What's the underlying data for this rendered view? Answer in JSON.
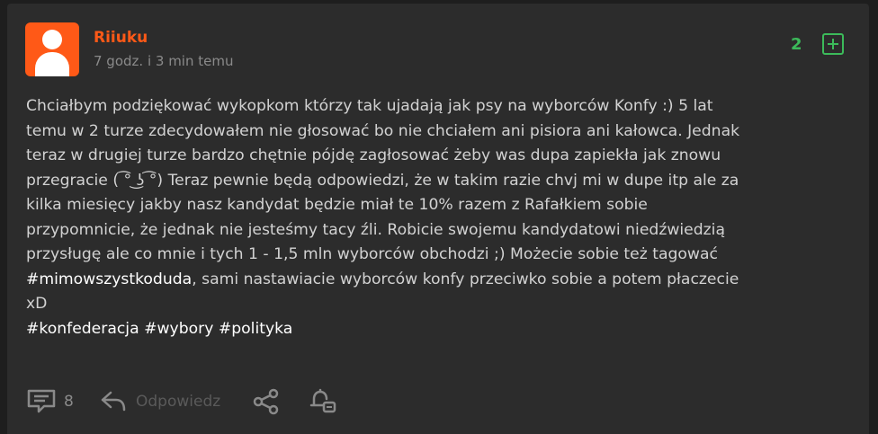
{
  "post": {
    "author": "Riiuku",
    "time_ago": "7 godz. i 3 min temu",
    "vote_count": "2",
    "lines": [
      "Chciałbym podziękować wykopkom którzy tak ujadają jak psy na wyborców Konfy :) 5 lat",
      "temu w 2 turze zdecydowałem nie głosować bo nie chciałem ani pisiora ani kałowca. Jednak",
      "teraz w drugiej turze bardzo chętnie pójdę zagłosować żeby was dupa zapiekła jak znowu",
      "przegracie ( ͡° ͜ʖ ͡°) Teraz pewnie będą odpowiedzi, że w takim razie chvj mi w dupe itp ale za",
      "kilka miesięcy jakby nasz kandydat będzie miał te 10% razem z Rafałkiem sobie",
      "przypomnicie, że jednak nie jesteśmy tacy źli. Robicie swojemu kandydatowi niedźwiedzią",
      "przysługę ale co mnie i tych 1 - 1,5 mln wyborców obchodzi ;) Możecie sobie też tagować"
    ],
    "line8_tag": "#mimowszystkoduda",
    "line8_rest": ", sami nastawiacie wyborców konfy przeciwko sobie a potem płaczecie",
    "line9": "xD",
    "tags": [
      "#konfederacja",
      "#wybory",
      "#polityka"
    ]
  },
  "actions": {
    "comments_count": "8",
    "reply_label": "Odpowiedz"
  },
  "colors": {
    "accent": "#ff5917",
    "vote_green": "#3cba5a",
    "background": "#2c2c2c",
    "text": "#d2d2d2",
    "muted": "#8a8a8a"
  },
  "icons": [
    "avatar-icon",
    "plus-vote-icon",
    "comments-icon",
    "reply-icon",
    "share-icon",
    "notification-bell-icon"
  ]
}
